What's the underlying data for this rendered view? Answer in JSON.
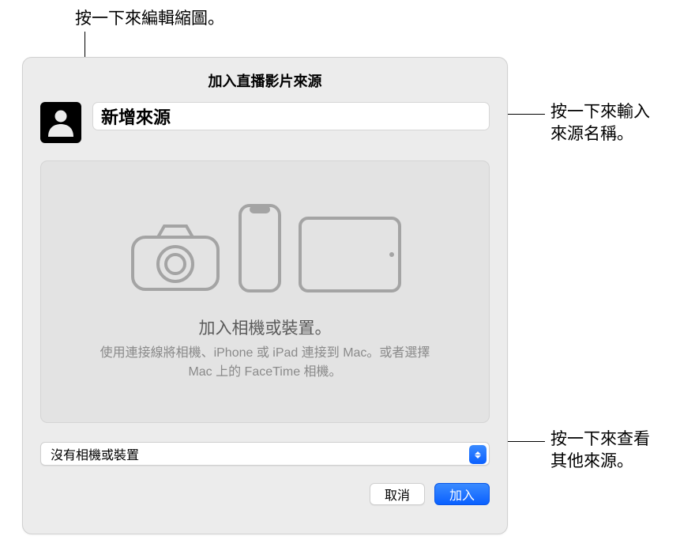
{
  "callouts": {
    "thumbnail": "按一下來編輯縮圖。",
    "name_line1": "按一下來輸入",
    "name_line2": "來源名稱。",
    "sources_line1": "按一下來查看",
    "sources_line2": "其他來源。"
  },
  "dialog": {
    "title": "加入直播影片來源",
    "source_name_value": "新增來源",
    "preview": {
      "headline": "加入相機或裝置。",
      "sub": "使用連接線將相機、iPhone 或 iPad 連接到 Mac。或者選擇 Mac 上的 FaceTime 相機。"
    },
    "device_select": {
      "value": "沒有相機或裝置"
    },
    "buttons": {
      "cancel": "取消",
      "add": "加入"
    }
  }
}
